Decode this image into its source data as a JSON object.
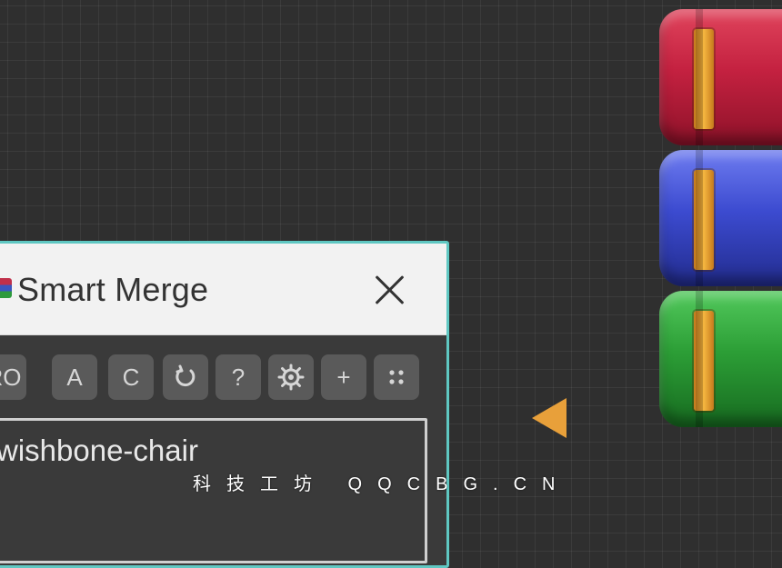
{
  "dialog": {
    "title": "Smart Merge",
    "close_icon": "close-icon",
    "toolbar": [
      {
        "label": "RO",
        "icon": "text-ro"
      },
      {
        "label": "A",
        "icon": "text-a"
      },
      {
        "label": "C",
        "icon": "text-c"
      },
      {
        "label": "",
        "icon": "refresh-icon"
      },
      {
        "label": "?",
        "icon": "help-icon"
      },
      {
        "label": "",
        "icon": "gear-icon"
      },
      {
        "label": "+",
        "icon": "plus-icon"
      },
      {
        "label": "",
        "icon": "grid-dots-icon"
      }
    ],
    "input_value": "wishbone-chair",
    "accent_color": "#5fc7c2"
  },
  "logo": {
    "icon": "stacked-books-logo",
    "colors": [
      "#c42140",
      "#3c4bd0",
      "#2c9e36"
    ]
  },
  "marker": {
    "icon": "triangle-left-icon",
    "color": "#e8a03a"
  },
  "watermark": {
    "text": "科技工坊 QQCBG.CN"
  }
}
